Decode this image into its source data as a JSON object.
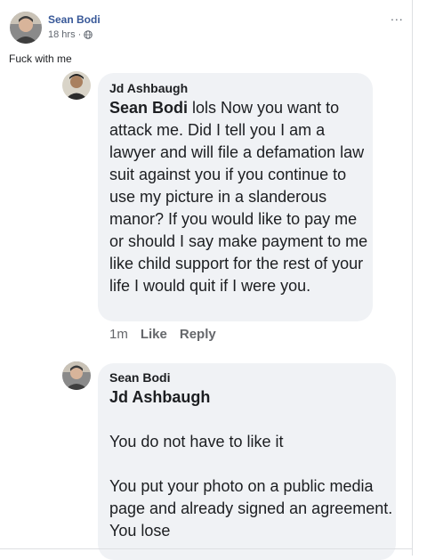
{
  "post": {
    "author": "Sean Bodi",
    "time": "18 hrs",
    "audience_icon": "globe-icon",
    "text": "Fuck with me",
    "more_icon": "..."
  },
  "comments": [
    {
      "author": "Jd Ashbaugh",
      "mention": "Sean Bodi",
      "text": " lols Now you want to attack me. Did I tell you I am a lawyer and will file a defamation law suit against you if you continue to use my picture in a slanderous manor? If you would like to pay me or should I say make payment to me like child support for the rest of your life I would quit if I were you.",
      "time": "1m",
      "like_label": "Like",
      "reply_label": "Reply"
    },
    {
      "author": "Sean Bodi",
      "mention": "Jd Ashbaugh",
      "paragraph1": "You do not have to like it",
      "paragraph2": "You put your photo on a public media page and already signed an agreement. You lose"
    }
  ],
  "colors": {
    "link_blue": "#385898",
    "bubble_bg": "#f0f2f5",
    "meta_gray": "#65676b"
  }
}
